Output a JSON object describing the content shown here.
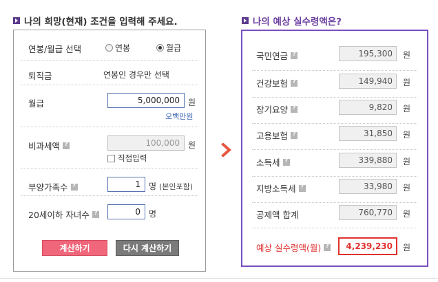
{
  "left_section": {
    "title": "나의 희망(현재) 조건을 입력해 주세요.",
    "salary_type": {
      "label": "연봉/월급 선택",
      "options": [
        "연봉",
        "월급"
      ],
      "selected": "월급"
    },
    "severance": {
      "label": "퇴직금",
      "value": "연봉인 경우만 선택"
    },
    "monthly_pay": {
      "label": "월급",
      "value": "5,000,000",
      "unit": "원",
      "hint": "오백만원"
    },
    "non_taxable": {
      "label": "비과세액",
      "value": "100,000",
      "unit": "원",
      "checkbox_label": "직접입력"
    },
    "dependents": {
      "label": "부양가족수",
      "value": "1",
      "unit": "명",
      "note": "(본인포함)"
    },
    "children_under_20": {
      "label": "20세이하 자녀수",
      "value": "0",
      "unit": "명"
    },
    "calc_button": "계산하기",
    "reset_button": "다시 계산하기"
  },
  "right_section": {
    "title": "나의 예상 실수령액은?",
    "unit": "원",
    "rows": [
      {
        "label": "국민연금",
        "value": "195,300"
      },
      {
        "label": "건강보험",
        "value": "149,940"
      },
      {
        "label": "장기요양",
        "value": "9,820"
      },
      {
        "label": "고용보험",
        "value": "31,850"
      },
      {
        "label": "소득세",
        "value": "339,880"
      },
      {
        "label": "지방소득세",
        "value": "33,980"
      },
      {
        "label": "공제액 합계",
        "value": "760,770"
      }
    ],
    "total": {
      "label": "예상 실수령액(월)",
      "value": "4,239,230"
    }
  },
  "colors": {
    "accent_purple": "#7b4fc0",
    "calc_button": "#f0667a",
    "reset_button": "#7a7a7a",
    "total_red": "#e0322f",
    "arrow": "#e8553e"
  },
  "icons": {
    "help": "question-mark-icon",
    "arrow": "chevron-right-icon"
  }
}
